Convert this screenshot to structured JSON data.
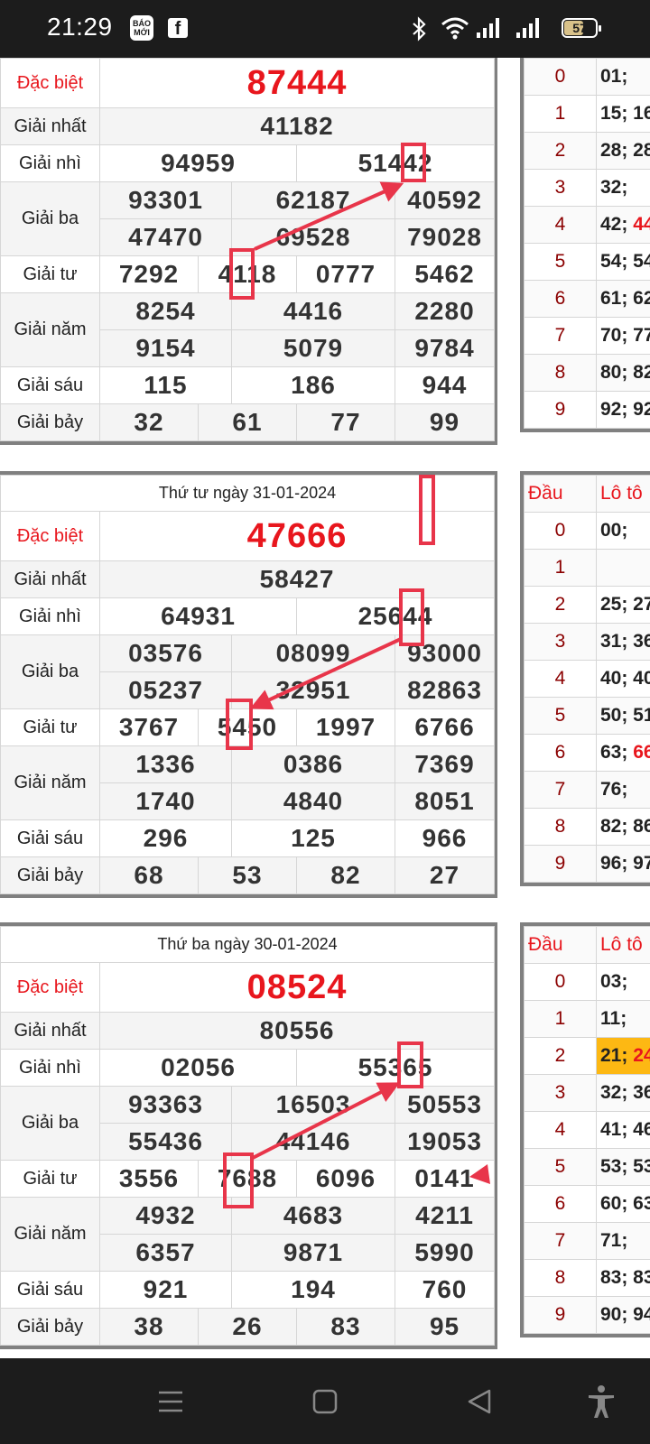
{
  "status_bar": {
    "time": "21:29",
    "notif_app_1": "BÁO MỚI",
    "notif_app_2": "f",
    "battery_level": "57",
    "icons": [
      "bluetooth-icon",
      "wifi-icon",
      "signal-icon",
      "signal-icon",
      "battery-icon"
    ]
  },
  "draws": [
    {
      "date": "",
      "special": "87444",
      "first": "41182",
      "second": [
        "94959",
        "51442"
      ],
      "third": [
        "93301",
        "62187",
        "40592",
        "47470",
        "69528",
        "79028"
      ],
      "fourth": [
        "7292",
        "4118",
        "0777",
        "5462"
      ],
      "fifth": [
        "8254",
        "4416",
        "2280",
        "9154",
        "5079",
        "9784"
      ],
      "sixth": [
        "115",
        "186",
        "944"
      ],
      "seventh": [
        "32",
        "61",
        "77",
        "99"
      ]
    },
    {
      "date": "Thứ tư ngày 31-01-2024",
      "special": "47666",
      "first": "58427",
      "second": [
        "64931",
        "25644"
      ],
      "third": [
        "03576",
        "08099",
        "93000",
        "05237",
        "32951",
        "82863"
      ],
      "fourth": [
        "3767",
        "5450",
        "1997",
        "6766"
      ],
      "fifth": [
        "1336",
        "0386",
        "7369",
        "1740",
        "4840",
        "8051"
      ],
      "sixth": [
        "296",
        "125",
        "966"
      ],
      "seventh": [
        "68",
        "53",
        "82",
        "27"
      ]
    },
    {
      "date": "Thứ ba ngày 30-01-2024",
      "special": "08524",
      "first": "80556",
      "second": [
        "02056",
        "55365"
      ],
      "third": [
        "93363",
        "16503",
        "50553",
        "55436",
        "44146",
        "19053"
      ],
      "fourth": [
        "3556",
        "7688",
        "6096",
        "0141"
      ],
      "fifth": [
        "4932",
        "4683",
        "4211",
        "6357",
        "9871",
        "5990"
      ],
      "sixth": [
        "921",
        "194",
        "760"
      ],
      "seventh": [
        "38",
        "26",
        "83",
        "95"
      ]
    }
  ],
  "labels": {
    "special": "Đặc biệt",
    "first": "Giải nhất",
    "second": "Giải nhì",
    "third": "Giải ba",
    "fourth": "Giải tư",
    "fifth": "Giải năm",
    "sixth": "Giải sáu",
    "seventh": "Giải bảy"
  },
  "loto": [
    {
      "header": null,
      "rows": [
        {
          "head": "0",
          "parts": [
            {
              "t": "01;"
            }
          ]
        },
        {
          "head": "1",
          "parts": [
            {
              "t": "15; 16"
            }
          ]
        },
        {
          "head": "2",
          "parts": [
            {
              "t": "28; 28"
            }
          ]
        },
        {
          "head": "3",
          "parts": [
            {
              "t": "32;"
            }
          ]
        },
        {
          "head": "4",
          "parts": [
            {
              "t": "42; "
            },
            {
              "t": "44",
              "red": true
            }
          ]
        },
        {
          "head": "5",
          "parts": [
            {
              "t": "54; 54"
            }
          ]
        },
        {
          "head": "6",
          "parts": [
            {
              "t": "61; 62"
            }
          ]
        },
        {
          "head": "7",
          "parts": [
            {
              "t": "70; 77"
            }
          ]
        },
        {
          "head": "8",
          "parts": [
            {
              "t": "80; 82"
            }
          ]
        },
        {
          "head": "9",
          "parts": [
            {
              "t": "92; 92"
            }
          ]
        }
      ]
    },
    {
      "header": {
        "head": "Đầu",
        "vals": "Lô tô"
      },
      "rows": [
        {
          "head": "0",
          "parts": [
            {
              "t": "00;"
            }
          ]
        },
        {
          "head": "1",
          "parts": [
            {
              "t": ""
            }
          ]
        },
        {
          "head": "2",
          "parts": [
            {
              "t": "25; 27"
            }
          ]
        },
        {
          "head": "3",
          "parts": [
            {
              "t": "31; 36"
            }
          ]
        },
        {
          "head": "4",
          "parts": [
            {
              "t": "40; 40"
            }
          ]
        },
        {
          "head": "5",
          "parts": [
            {
              "t": "50; 51"
            }
          ]
        },
        {
          "head": "6",
          "parts": [
            {
              "t": "63; "
            },
            {
              "t": "66",
              "red": true
            }
          ]
        },
        {
          "head": "7",
          "parts": [
            {
              "t": "76;"
            }
          ]
        },
        {
          "head": "8",
          "parts": [
            {
              "t": "82; 86"
            }
          ]
        },
        {
          "head": "9",
          "parts": [
            {
              "t": "96; 97"
            }
          ]
        }
      ]
    },
    {
      "header": {
        "head": "Đầu",
        "vals": "Lô tô"
      },
      "rows": [
        {
          "head": "0",
          "parts": [
            {
              "t": "03;"
            }
          ]
        },
        {
          "head": "1",
          "parts": [
            {
              "t": "11;"
            }
          ]
        },
        {
          "head": "2",
          "highlight": true,
          "parts": [
            {
              "t": "21; "
            },
            {
              "t": "24",
              "red": true
            }
          ]
        },
        {
          "head": "3",
          "parts": [
            {
              "t": "32; 36"
            }
          ]
        },
        {
          "head": "4",
          "parts": [
            {
              "t": "41; 46"
            }
          ]
        },
        {
          "head": "5",
          "parts": [
            {
              "t": "53; 53"
            }
          ]
        },
        {
          "head": "6",
          "parts": [
            {
              "t": "60; 63"
            }
          ]
        },
        {
          "head": "7",
          "parts": [
            {
              "t": "71;"
            }
          ]
        },
        {
          "head": "8",
          "parts": [
            {
              "t": "83; 83"
            }
          ]
        },
        {
          "head": "9",
          "parts": [
            {
              "t": "90; 94"
            }
          ]
        }
      ]
    }
  ],
  "annotation_color": "#e8354a",
  "nav_bar": {
    "icons": [
      "menu-icon",
      "home-icon",
      "back-icon",
      "accessibility-icon"
    ]
  }
}
